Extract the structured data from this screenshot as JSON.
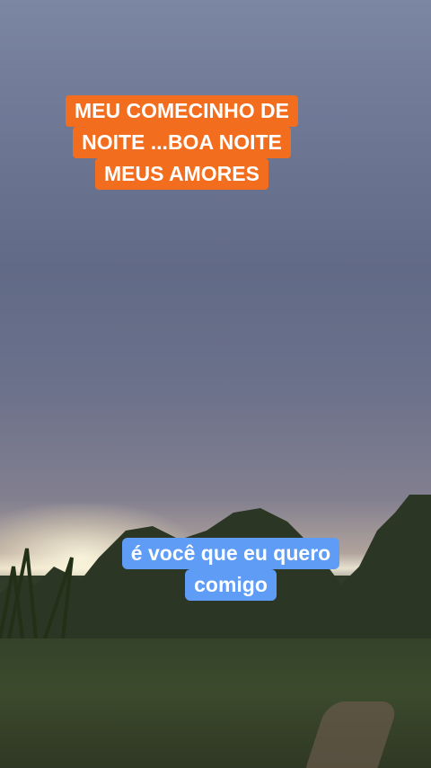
{
  "captions": {
    "top": [
      "MEU COMECINHO DE",
      "NOITE ...BOA NOITE",
      "MEUS AMORES"
    ],
    "bottom": [
      "é você que eu quero",
      "comigo"
    ]
  },
  "colors": {
    "top_caption_bg": "#f26d1d",
    "bottom_caption_bg": "#5e9cf5"
  }
}
